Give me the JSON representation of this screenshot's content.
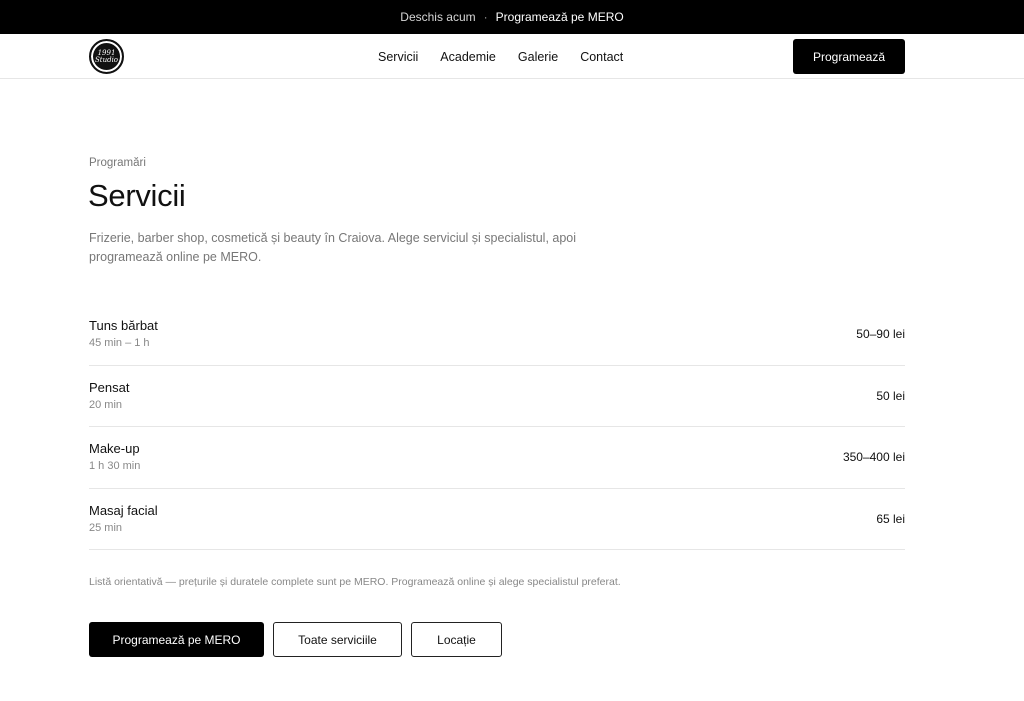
{
  "topbar": {
    "status": "Deschis acum",
    "separator": "·",
    "link": "Programează pe MERO"
  },
  "nav": {
    "logo_text": "1991\nStudio",
    "items": [
      "Servicii",
      "Academie",
      "Galerie",
      "Contact"
    ],
    "cta": "Programează"
  },
  "header": {
    "eyebrow": "Programări",
    "title": "Servicii",
    "description": "Frizerie, barber shop, cosmetică și beauty în Craiova. Alege serviciul și specialistul, apoi programează online pe MERO."
  },
  "services": [
    {
      "name": "Tuns bărbat",
      "duration": "45 min – 1 h",
      "price": "50–90 lei"
    },
    {
      "name": "Pensat",
      "duration": "20 min",
      "price": "50 lei"
    },
    {
      "name": "Make-up",
      "duration": "1 h 30 min",
      "price": "350–400 lei"
    },
    {
      "name": "Masaj facial",
      "duration": "25 min",
      "price": "65 lei"
    }
  ],
  "note": "Listă orientativă — prețurile și duratele complete sunt pe MERO. Programează online și alege specialistul preferat.",
  "actions": {
    "primary": "Programează pe MERO",
    "all_services": "Toate serviciile",
    "location": "Locație"
  }
}
